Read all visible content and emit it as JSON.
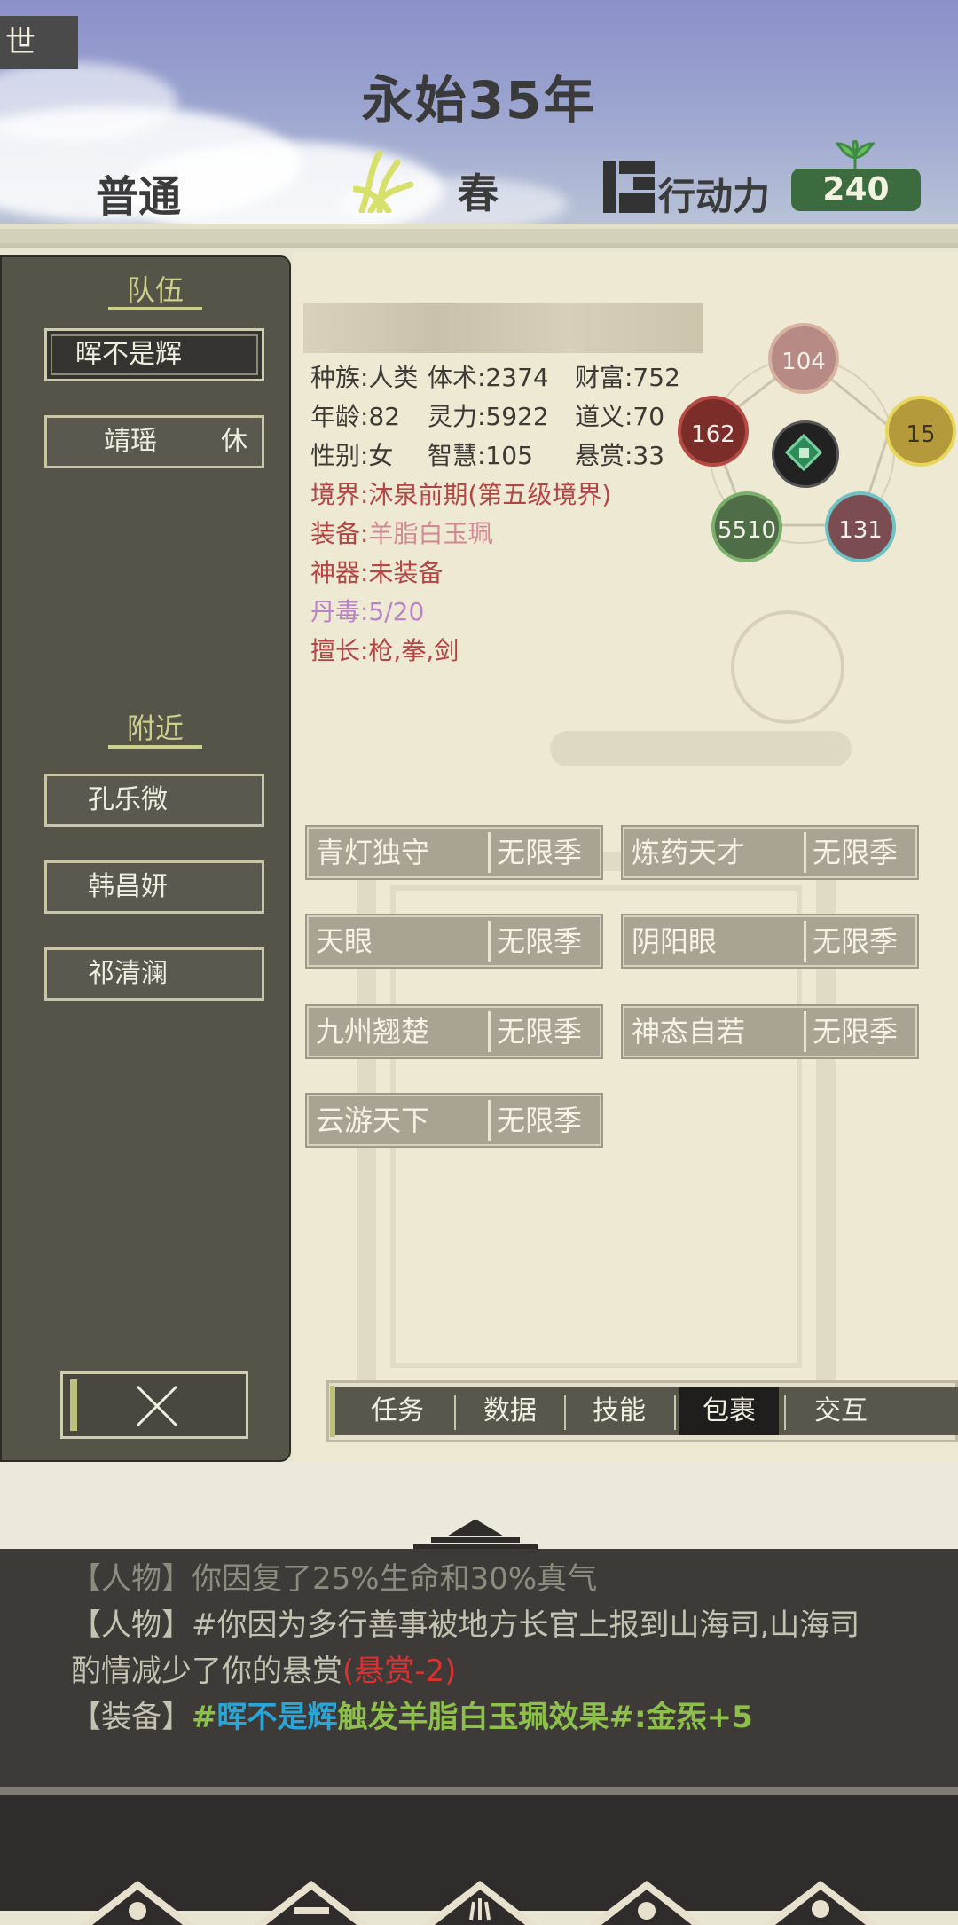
{
  "header": {
    "world_tab": "世",
    "year": "永始35年",
    "difficulty": "普通",
    "season": "春",
    "action_points_label": "行动力",
    "action_points_value": "240"
  },
  "left_panel": {
    "team_title": "队伍",
    "team": [
      {
        "name": "晖不是辉",
        "status": "",
        "selected": true
      },
      {
        "name": "靖瑶",
        "status": "休",
        "selected": false
      }
    ],
    "nearby_title": "附近",
    "nearby": [
      {
        "name": "孔乐微"
      },
      {
        "name": "韩昌妍"
      },
      {
        "name": "祁清澜"
      }
    ]
  },
  "character": {
    "race": "种族:人类",
    "body": "体术:2374",
    "wealth": "财富:752",
    "age": "年龄:82",
    "spirit": "灵力:5922",
    "righteousness": "道义:70",
    "gender": "性别:女",
    "wisdom": "智慧:105",
    "bounty": "悬赏:33",
    "realm": "境界:沐泉前期(第五级境界)",
    "equipment_label": "装备:",
    "equipment_value": "羊脂白玉珮",
    "artifact": "神器:未装备",
    "pill_poison": "丹毒:5/20",
    "specialty": "擅长:枪,拳,剑"
  },
  "elements": {
    "top": "104",
    "left": "162",
    "right": "15",
    "bottom_left": "5510",
    "bottom_right": "131"
  },
  "traits": [
    {
      "name": "青灯独守",
      "duration": "无限季"
    },
    {
      "name": "炼药天才",
      "duration": "无限季"
    },
    {
      "name": "天眼",
      "duration": "无限季"
    },
    {
      "name": "阴阳眼",
      "duration": "无限季"
    },
    {
      "name": "九州翘楚",
      "duration": "无限季"
    },
    {
      "name": "神态自若",
      "duration": "无限季"
    },
    {
      "name": "云游天下",
      "duration": "无限季"
    }
  ],
  "tabs": [
    {
      "label": "任务",
      "active": false
    },
    {
      "label": "数据",
      "active": false
    },
    {
      "label": "技能",
      "active": false
    },
    {
      "label": "包裹",
      "active": true
    },
    {
      "label": "交互",
      "active": false
    }
  ],
  "log": {
    "line0": "【人物】你因复了25%生命和30%真气",
    "line1_tag": "【人物】",
    "line1_text": "#你因为多行善事被地方长官上报到山海司,山海司",
    "line2_text": "酌情减少了你的悬赏",
    "line2_red": "(悬赏-2)",
    "line3_tag": "【装备】",
    "line3_hash": "#",
    "line3_name": "晖不是辉",
    "line3_text": "触发羊脂白玉珮效果#:金炁+5"
  },
  "colors": {
    "accent_green": "#3b6b3e",
    "panel_dark": "#565349",
    "trait_bg": "#a8a392",
    "log_red": "#d83232",
    "log_blue": "#29a6d8",
    "log_green": "#8cc04a"
  }
}
